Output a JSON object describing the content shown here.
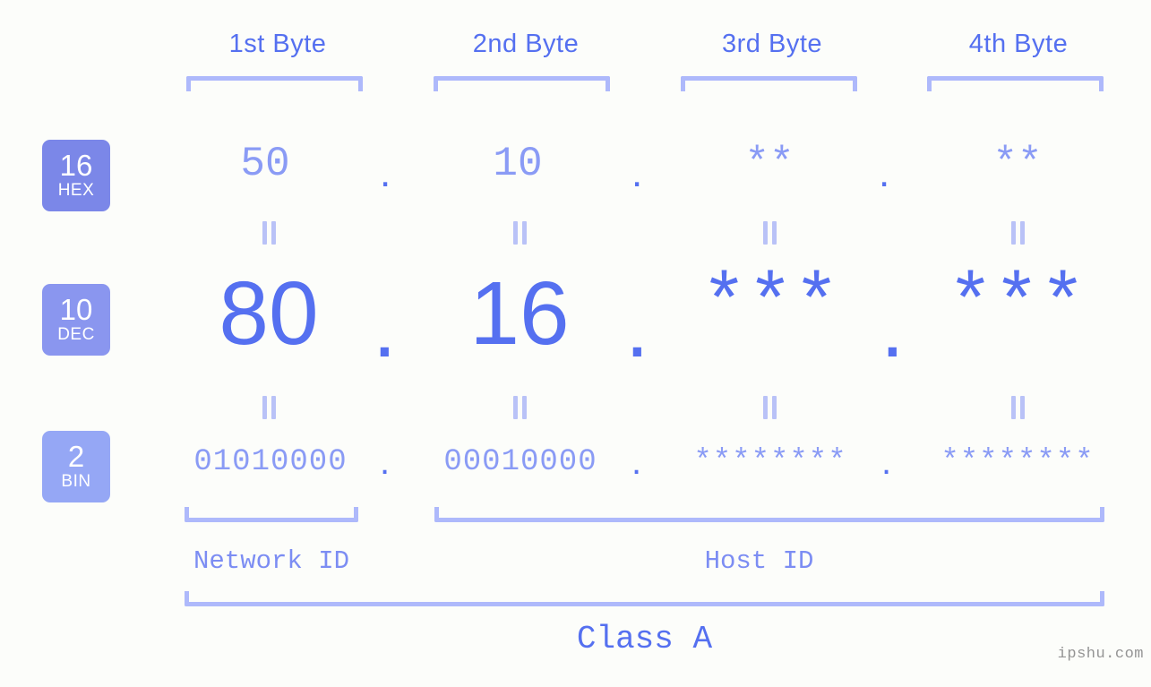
{
  "watermark": "ipshu.com",
  "colors": {
    "background": "#fcfdfa",
    "accent_strong": "#5570f0",
    "accent_light": "#8a9bf5",
    "bracket": "#aeb9fb",
    "badge_hex": "#7b87e8",
    "badge_dec": "#8a96ef",
    "badge_bin": "#95a7f5",
    "watermark": "#949494"
  },
  "byte_headers": [
    {
      "label": "1st Byte"
    },
    {
      "label": "2nd Byte"
    },
    {
      "label": "3rd Byte"
    },
    {
      "label": "4th Byte"
    }
  ],
  "bases": [
    {
      "id": "hex",
      "number": "16",
      "name": "HEX"
    },
    {
      "id": "dec",
      "number": "10",
      "name": "DEC"
    },
    {
      "id": "bin",
      "number": "2",
      "name": "BIN"
    }
  ],
  "rows": {
    "hex": {
      "bytes": [
        "50",
        "10",
        "**",
        "**"
      ],
      "separator": "."
    },
    "dec": {
      "bytes": [
        "80",
        "16",
        "***",
        "***"
      ],
      "separator": "."
    },
    "bin": {
      "bytes": [
        "01010000",
        "00010000",
        "********",
        "********"
      ],
      "separator": "."
    }
  },
  "equals_symbol": "=",
  "sections": [
    {
      "label": "Network ID"
    },
    {
      "label": "Host ID"
    }
  ],
  "class": {
    "label": "Class A"
  }
}
